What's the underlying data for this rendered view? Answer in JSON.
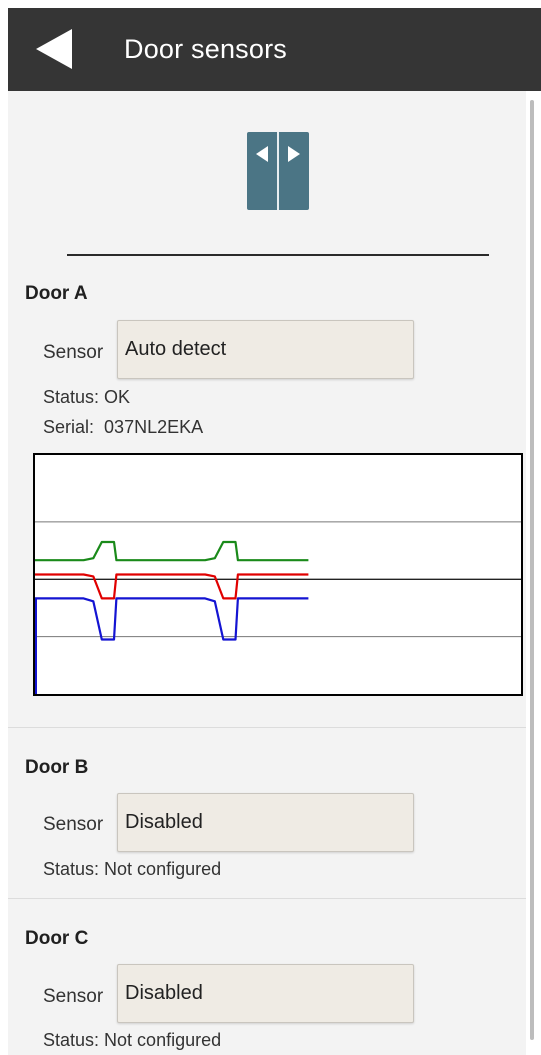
{
  "appbar": {
    "title": "Door sensors",
    "back_icon": "back-arrow-icon"
  },
  "header_icon": "sliding-door-icon",
  "doors": [
    {
      "title": "Door A",
      "sensor_label": "Sensor",
      "sensor_value": "Auto detect",
      "status_label": "Status:",
      "status_value": "OK",
      "serial_label": "Serial:",
      "serial_value": "037NL2EKA"
    },
    {
      "title": "Door B",
      "sensor_label": "Sensor",
      "sensor_value": "Disabled",
      "status_label": "Status:",
      "status_value": "Not configured"
    },
    {
      "title": "Door C",
      "sensor_label": "Sensor",
      "sensor_value": "Disabled",
      "status_label": "Status:",
      "status_value": "Not configured"
    }
  ],
  "colors": {
    "appbar": "#353535",
    "door_icon": "#4b7585",
    "green": "#1a8a1a",
    "red": "#e00000",
    "blue": "#1414d2"
  },
  "chart_data": {
    "type": "line",
    "x": [
      0,
      8,
      9.6,
      11,
      13,
      13.4,
      28,
      29.6,
      31,
      33,
      33.4,
      45
    ],
    "series": [
      {
        "color": "#1a8a1a",
        "values": [
          0.6,
          0.6,
          0.62,
          0.79,
          0.79,
          0.6,
          0.6,
          0.62,
          0.79,
          0.79,
          0.6,
          0.6
        ]
      },
      {
        "color": "#e00000",
        "values": [
          0.45,
          0.45,
          0.43,
          0.2,
          0.2,
          0.45,
          0.45,
          0.43,
          0.2,
          0.2,
          0.45,
          0.45
        ]
      },
      {
        "color": "#1414d2",
        "values": [
          0.2,
          0.2,
          0.17,
          -0.23,
          -0.23,
          0.2,
          0.2,
          0.17,
          -0.23,
          -0.23,
          0.2,
          0.2
        ]
      }
    ],
    "xlim": [
      0,
      80
    ],
    "ylim": [
      -0.8,
      1.7
    ],
    "gridlines": [
      1.0,
      0.4,
      -0.2
    ]
  }
}
